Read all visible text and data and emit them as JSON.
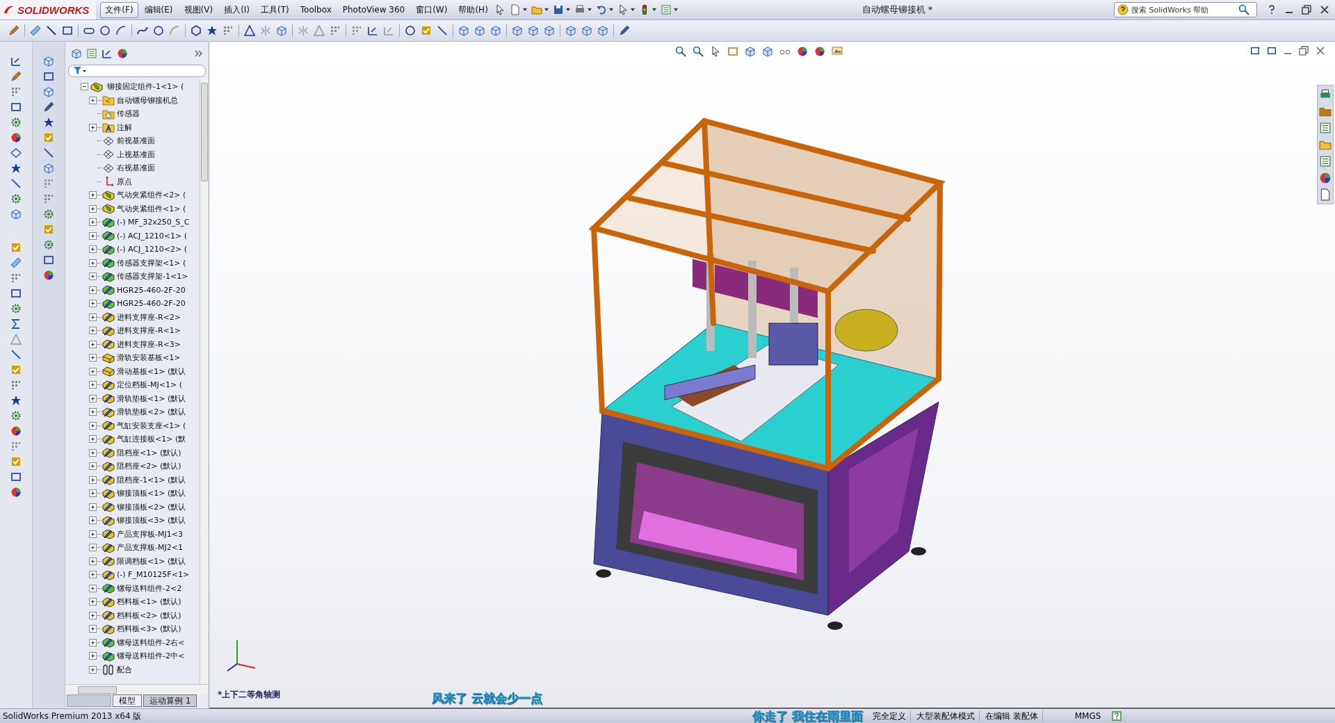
{
  "app": {
    "logo": "SOLIDWORKS",
    "title": "自动螺母铆接机 *"
  },
  "menu": [
    {
      "label": "文件(F)",
      "selected": true
    },
    {
      "label": "编辑(E)",
      "selected": false
    },
    {
      "label": "视图(V)",
      "selected": false
    },
    {
      "label": "插入(I)",
      "selected": false
    },
    {
      "label": "工具(T)",
      "selected": false
    },
    {
      "label": "Toolbox",
      "selected": false
    },
    {
      "label": "PhotoView 360",
      "selected": false
    },
    {
      "label": "窗口(W)",
      "selected": false
    },
    {
      "label": "帮助(H)",
      "selected": false
    }
  ],
  "search": {
    "placeholder": "搜索 SolidWorks 帮助"
  },
  "tree": {
    "root": {
      "label": "铆接固定组件-1<1> (",
      "expanded": true,
      "children": [
        {
          "label": "自动镙母铆接机总",
          "kind": "folder",
          "expandable": true
        },
        {
          "label": "传感器",
          "kind": "sensor",
          "expandable": false
        },
        {
          "label": "注解",
          "kind": "annotation",
          "expandable": true
        },
        {
          "label": "前视基准面",
          "kind": "plane",
          "expandable": false
        },
        {
          "label": "上视基准面",
          "kind": "plane",
          "expandable": false
        },
        {
          "label": "右视基准面",
          "kind": "plane",
          "expandable": false
        },
        {
          "label": "原点",
          "kind": "origin",
          "expandable": false
        },
        {
          "label": "气动夹紧组件<2> (",
          "kind": "assembly",
          "expandable": true
        },
        {
          "label": "气动夹紧组件<1> (",
          "kind": "assembly",
          "expandable": true
        },
        {
          "label": "(-) MF_32x250_S_C",
          "kind": "part_green",
          "expandable": true
        },
        {
          "label": "(-) ACJ_1210<1> (",
          "kind": "part_green",
          "expandable": true
        },
        {
          "label": "(-) ACJ_1210<2> (",
          "kind": "part_green",
          "expandable": true
        },
        {
          "label": "传感器支撑架<1> (",
          "kind": "part_green",
          "expandable": true
        },
        {
          "label": "传感器支撑架-1<1>",
          "kind": "part_green",
          "expandable": true
        },
        {
          "label": "HGR25-460-2F-20",
          "kind": "part_green",
          "expandable": true
        },
        {
          "label": "HGR25-460-2F-20",
          "kind": "part_green",
          "expandable": true
        },
        {
          "label": "进料支撑座-R<2>",
          "kind": "part",
          "expandable": true
        },
        {
          "label": "进料支撑座-R<1>",
          "kind": "part",
          "expandable": true
        },
        {
          "label": "进料支撑座-R<3>",
          "kind": "part",
          "expandable": true
        },
        {
          "label": "滑轨安装基板<1>",
          "kind": "block",
          "expandable": true
        },
        {
          "label": "滑动基板<1> (默认",
          "kind": "block",
          "expandable": true
        },
        {
          "label": "定位档板-MJ<1> (",
          "kind": "part",
          "expandable": true
        },
        {
          "label": "滑轨垫板<1> (默认",
          "kind": "part",
          "expandable": true
        },
        {
          "label": "滑轨垫板<2> (默认",
          "kind": "part",
          "expandable": true
        },
        {
          "label": "气缸安装支座<1> (",
          "kind": "part",
          "expandable": true
        },
        {
          "label": "气缸连接板<1> (默",
          "kind": "part",
          "expandable": true
        },
        {
          "label": "阻档座<1> (默认)",
          "kind": "part",
          "expandable": true
        },
        {
          "label": "阻档座<2> (默认)",
          "kind": "part",
          "expandable": true
        },
        {
          "label": "阻档座-1<1> (默认",
          "kind": "part",
          "expandable": true
        },
        {
          "label": "铆接顶板<1> (默认",
          "kind": "part",
          "expandable": true
        },
        {
          "label": "铆接顶板<2> (默认",
          "kind": "part",
          "expandable": true
        },
        {
          "label": "铆接顶板<3> (默认",
          "kind": "part",
          "expandable": true
        },
        {
          "label": "产品支撑板-MJ1<3",
          "kind": "part",
          "expandable": true
        },
        {
          "label": "产品支撑板-MJ2<1",
          "kind": "part",
          "expandable": true
        },
        {
          "label": "限调档板<1> (默认",
          "kind": "part",
          "expandable": true
        },
        {
          "label": "(-) F_M10125F<1>",
          "kind": "part",
          "expandable": true
        },
        {
          "label": "镙母送料组件-2<2",
          "kind": "part_green",
          "expandable": true
        },
        {
          "label": "档料板<1> (默认)",
          "kind": "part",
          "expandable": true
        },
        {
          "label": "档料板<2> (默认)",
          "kind": "part",
          "expandable": true
        },
        {
          "label": "档料板<3> (默认)",
          "kind": "part",
          "expandable": true
        },
        {
          "label": "镙母送料组件-2右<",
          "kind": "part_green",
          "expandable": true
        },
        {
          "label": "镙母送料组件-2中<",
          "kind": "part_green",
          "expandable": true
        },
        {
          "label": "配合",
          "kind": "mates",
          "expandable": true
        }
      ]
    }
  },
  "bottom_tabs": [
    {
      "label": "模型",
      "selected": true
    },
    {
      "label": "运动算例 1",
      "selected": false
    }
  ],
  "viewport": {
    "view_name": "*上下二等角轴测",
    "overlay_text": "风来了  云就会少一点"
  },
  "status_bar": {
    "product": "SolidWorks Premium 2013 x64 版",
    "overlay_text": "你走了  我住在雨里面",
    "fields": [
      "完全定义",
      "大型装配体模式",
      "在编辑 装配体"
    ],
    "units": "MMGS"
  }
}
